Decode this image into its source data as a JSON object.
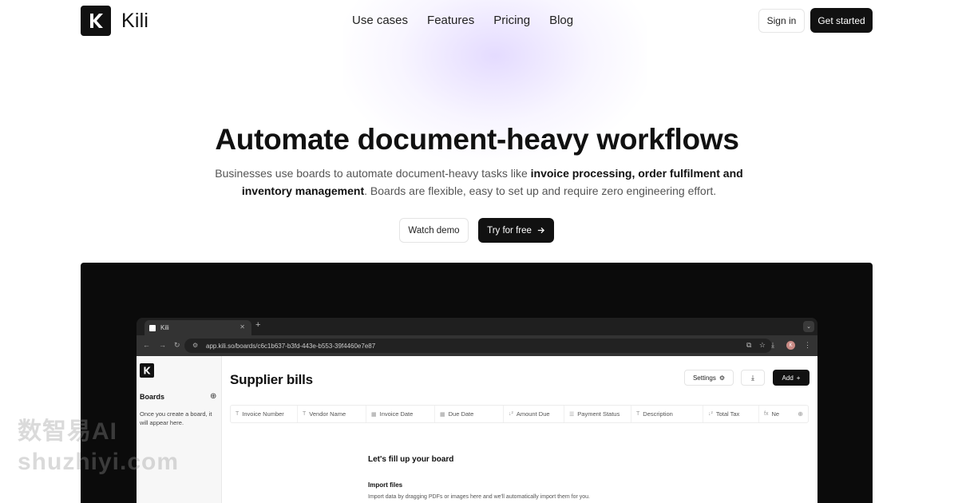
{
  "nav": {
    "logo_text": "Kili",
    "links": [
      "Use cases",
      "Features",
      "Pricing",
      "Blog"
    ],
    "signin_label": "Sign in",
    "getstarted_label": "Get started"
  },
  "hero": {
    "title": "Automate document-heavy workflows",
    "sub_pre": "Businesses use boards to automate document-heavy tasks like ",
    "sub_bold": "invoice processing, order fulfilment and inventory management",
    "sub_post": ". Boards are flexible, easy to set up and require zero engineering effort.",
    "watch_label": "Watch demo",
    "try_label": "Try for free"
  },
  "browser": {
    "tab_title": "Kili",
    "url": "app.kili.so/boards/c6c1b637-b3fd-443e-b553-39f4460e7e87",
    "profile_initial": "K"
  },
  "app": {
    "sidebar_title": "Boards",
    "sidebar_hint": "Once you create a board, it will appear here.",
    "page_title": "Supplier bills",
    "settings_label": "Settings",
    "add_label": "Add",
    "columns": [
      {
        "icon": "T",
        "label": "Invoice Number"
      },
      {
        "icon": "T",
        "label": "Vendor Name"
      },
      {
        "icon": "▦",
        "label": "Invoice Date"
      },
      {
        "icon": "▦",
        "label": "Due Date"
      },
      {
        "icon": "↓²",
        "label": "Amount Due"
      },
      {
        "icon": "☰",
        "label": "Payment Status"
      },
      {
        "icon": "T",
        "label": "Description"
      },
      {
        "icon": "↓²",
        "label": "Total Tax"
      },
      {
        "icon": "fx",
        "label": "Ne"
      }
    ],
    "empty_title": "Let's fill up your board",
    "import_title": "Import files",
    "import_text": "Import data by dragging PDFs or images here and we'll automatically import them for you."
  },
  "watermark": {
    "line1": "数智易AI",
    "line2": "shuzhiyi.com"
  },
  "icons": {
    "logo": "kili-logo-icon",
    "arrow": "arrow-right-icon",
    "settings": "gear-icon",
    "download": "download-icon",
    "plus": "plus-icon"
  }
}
